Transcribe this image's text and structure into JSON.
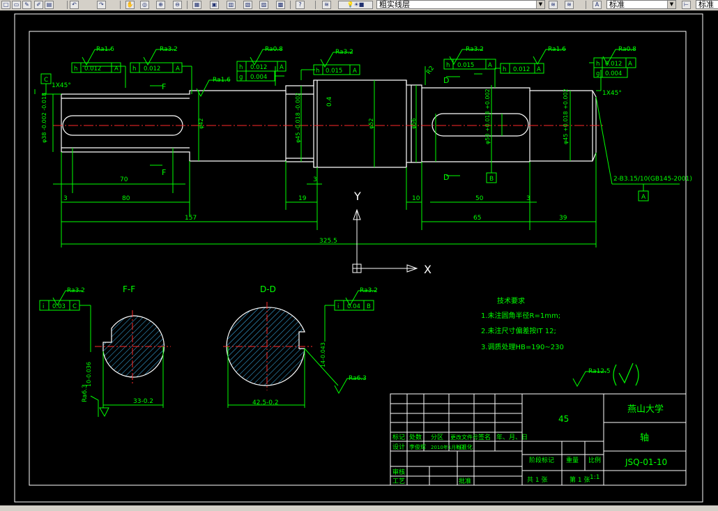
{
  "toolbar": {
    "layer_name": "粗实线层",
    "text_style": "标准",
    "dim_style": "标准",
    "icons": [
      "new-icon",
      "open-icon",
      "pencil-icon",
      "match-properties-icon",
      "undo-icon",
      "redo-icon",
      "pan-icon",
      "zoom-realtime-icon",
      "zoom-window-icon",
      "zoom-previous-icon",
      "properties-icon",
      "design-center-icon",
      "tool-palettes-icon",
      "sheet-set-icon",
      "markup-icon",
      "calculator-icon",
      "help-icon",
      "layer-manager-icon",
      "layer-state-icon",
      "layer-previous-icon",
      "text-style-icon",
      "dim-style-icon"
    ]
  },
  "drawing": {
    "roughness": {
      "r1": "Ra1.6",
      "r2": "Ra3.2",
      "r3": "Ra0.8",
      "r4": "Ra3.2",
      "r5": "Ra1.6",
      "r6": "Ra3.2",
      "r7": "Ra1.6",
      "r8": "Ra0.8",
      "r9": "Ra3.2",
      "r10": "Ra3.2",
      "r11": "Ra6.3",
      "r12": "Ra6.3",
      "r13": "Ra12.5"
    },
    "tolerances": {
      "t1": [
        "h",
        "0.012",
        "A"
      ],
      "t2": [
        "h",
        "0.012",
        "A"
      ],
      "t3a": [
        "h",
        "0.012",
        "A"
      ],
      "t3b": [
        "g",
        "0.004"
      ],
      "t4": [
        "h",
        "0.015",
        "A"
      ],
      "t5": [
        "h",
        "0.015",
        "A"
      ],
      "t6": [
        "h",
        "0.012",
        "A"
      ],
      "t7a": [
        "h",
        "0.012",
        "A"
      ],
      "t7b": [
        "g",
        "0.004"
      ],
      "t8": [
        "i",
        "0.03",
        "C"
      ],
      "t9": [
        "i",
        "0.04",
        "B"
      ]
    },
    "datums": {
      "c": "C",
      "b": "B",
      "a": "A"
    },
    "sections": {
      "f1": "F",
      "f2": "F",
      "d1": "D",
      "d2": "D",
      "ff": "F-F",
      "dd": "D-D"
    },
    "chamfers": {
      "left": "1X45°",
      "right": "1X45°"
    },
    "diameters": {
      "d1": "φ38 -0.002 -0.018",
      "d2": "φ42",
      "d3": "φ45 -0.018 -0.002",
      "d4": "φ52",
      "d5": "φ56",
      "d6": "φ50 +0.018 +0.002",
      "d7": "φ45 +0.018 +0.002"
    },
    "dims": {
      "a": "3",
      "b": "70",
      "c": "80",
      "d": "157",
      "e": "19",
      "f": "3",
      "g": "10",
      "h": "50",
      "i": "3",
      "j": "65",
      "k": "39",
      "l": "325.5",
      "m": "0.4",
      "n": "R2",
      "ff_w": "33-0.2",
      "ff_k": "10-0.036",
      "dd_w": "42.5-0.2",
      "dd_k": "14-0.043"
    },
    "center_holes": "2-B3.15/10(GB145-2001)",
    "ucs": {
      "x": "X",
      "y": "Y"
    },
    "tech_title": "技术要求",
    "tech_reqs": [
      "1.未注圆角半径R=1mm;",
      "2.未注尺寸偏差按IT 12;",
      "3.调质处理HB=190~230"
    ],
    "title_block": {
      "material": "45",
      "org": "燕山大学",
      "part_name": "轴",
      "drawing_no": "JSQ-01-10",
      "scale_label": "比例",
      "scale": "1:1",
      "stage": "阶段标记",
      "weight": "重量",
      "hdr": [
        "标记",
        "处数",
        "分区",
        "更改文件号",
        "签名",
        "年、月、日"
      ],
      "design_row": [
        "设计",
        "李俊辉",
        "2010年1月7日",
        "标准化"
      ],
      "review": "审核",
      "process": "工艺",
      "approve": "批准",
      "sheets": "共 1 张",
      "sheet_no": "第 1 张"
    }
  }
}
